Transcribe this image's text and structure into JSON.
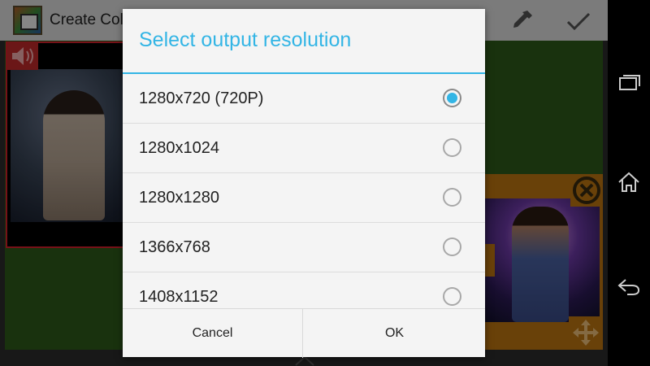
{
  "app_bar": {
    "title": "Create Col",
    "app_icon": "collage-app-icon",
    "actions": [
      "eyedropper-icon",
      "checkmark-icon"
    ]
  },
  "canvas": {
    "background_color": "#2e5b1a",
    "left_clip": {
      "border_color": "#d8202c",
      "badge_icon": "speaker-icon"
    },
    "right_clip": {
      "border_color": "#c07712",
      "icons": [
        "close-circle-icon",
        "move-arrows-icon"
      ]
    }
  },
  "dialog": {
    "title": "Select output resolution",
    "accent_color": "#33b5e5",
    "options": [
      {
        "label": "1280x720 (720P)",
        "selected": true
      },
      {
        "label": "1280x1024",
        "selected": false
      },
      {
        "label": "1280x1280",
        "selected": false
      },
      {
        "label": "1366x768",
        "selected": false
      },
      {
        "label": "1408x1152",
        "selected": false
      }
    ],
    "cancel_label": "Cancel",
    "ok_label": "OK"
  },
  "nav_bar": {
    "buttons": [
      "recent-apps-icon",
      "home-icon",
      "back-icon"
    ]
  }
}
